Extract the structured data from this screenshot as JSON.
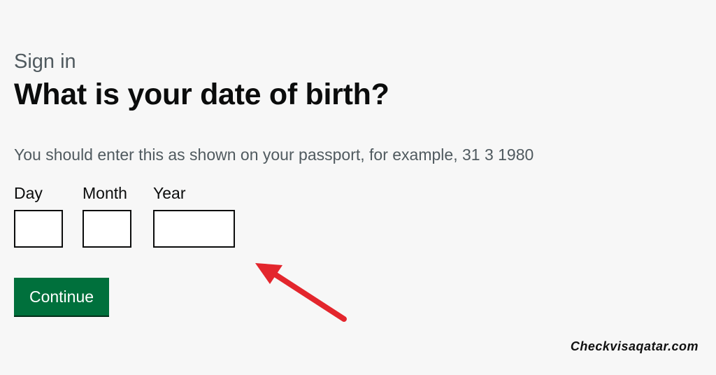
{
  "form": {
    "caption": "Sign in",
    "heading": "What is your date of birth?",
    "hint": "You should enter this as shown on your passport, for example, 31 3 1980",
    "fields": {
      "day": {
        "label": "Day",
        "value": ""
      },
      "month": {
        "label": "Month",
        "value": ""
      },
      "year": {
        "label": "Year",
        "value": ""
      }
    },
    "continue_label": "Continue"
  },
  "annotation": {
    "arrow_color": "#e3262d"
  },
  "watermark": "Checkvisaqatar.com",
  "colors": {
    "button": "#00703c",
    "text": "#0b0c0c",
    "secondary_text": "#505a5f"
  }
}
